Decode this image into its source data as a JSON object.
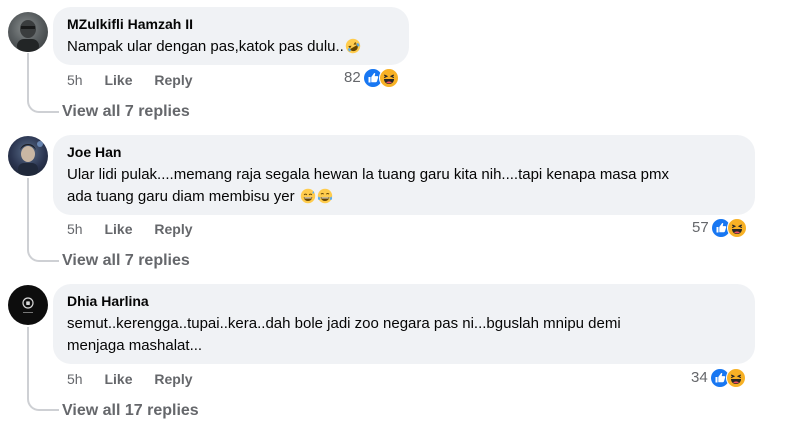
{
  "comments": [
    {
      "author": "MZulkifli Hamzah II",
      "text_lines": [
        "Nampak ular dengan pas,katok pas dulu.."
      ],
      "time": "5h",
      "like_label": "Like",
      "reply_label": "Reply",
      "reaction_count": "82",
      "replies_label": "View all 7 replies",
      "trailing_emojis": [
        "rofl"
      ]
    },
    {
      "author": "Joe Han",
      "text_lines": [
        "Ular lidi pulak....memang raja segala hewan la tuang garu kita nih....tapi kenapa masa pmx",
        "ada tuang garu diam membisu yer"
      ],
      "time": "5h",
      "like_label": "Like",
      "reply_label": "Reply",
      "reaction_count": "57",
      "replies_label": "View all 7 replies",
      "trailing_emojis": [
        "grin-sweat",
        "joy"
      ]
    },
    {
      "author": "Dhia Harlina",
      "text_lines": [
        "semut..kerengga..tupai..kera..dah bole jadi zoo negara pas ni...bguslah mnipu demi",
        "menjaga mashalat..."
      ],
      "time": "5h",
      "like_label": "Like",
      "reply_label": "Reply",
      "reaction_count": "34",
      "replies_label": "View all 17 replies",
      "trailing_emojis": []
    }
  ],
  "colors": {
    "bubble": "#f0f2f5",
    "meta": "#65676b",
    "like_blue": "#1877f2",
    "haha_yellow": "#f7b125"
  },
  "icons": {
    "reaction_1": "like-icon",
    "reaction_2": "haha-icon"
  }
}
